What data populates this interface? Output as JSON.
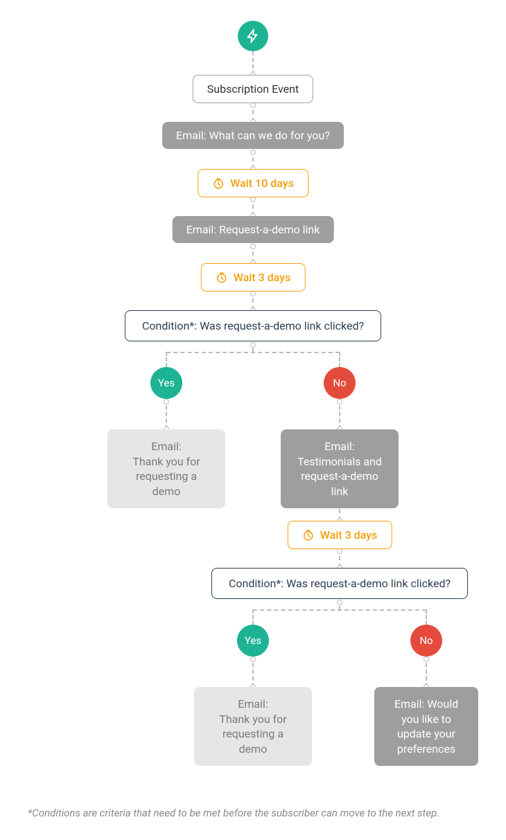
{
  "trigger": {
    "label": "Subscription Event"
  },
  "steps": {
    "email1": "Email: What can we do for you?",
    "wait1": "Wait 10 days",
    "email2": "Email: Request-a-demo link",
    "wait2": "Wait 3 days",
    "cond1": "Condition*: Was request-a-demo link clicked?",
    "yes1": "Yes",
    "no1": "No",
    "emailYes1": "Email:\nThank you for\nrequesting a\ndemo",
    "emailNo1": "Email:\nTestimonials and\nrequest-a-demo\nlink",
    "wait3": "Wait 3 days",
    "cond2": "Condition*: Was request-a-demo link clicked?",
    "yes2": "Yes",
    "no2": "No",
    "emailYes2": "Email:\nThank you for\nrequesting a\ndemo",
    "emailNo2": "Email: Would\nyou like to\nupdate your\npreferences"
  },
  "footnote": "*Conditions are criteria that need to be met before the subscriber can move to the next step.",
  "colors": {
    "green": "#1eb395",
    "red": "#e54b3c",
    "orange": "#f59e0b",
    "gray": "#9e9e9e",
    "dark": "#2c3e50"
  }
}
